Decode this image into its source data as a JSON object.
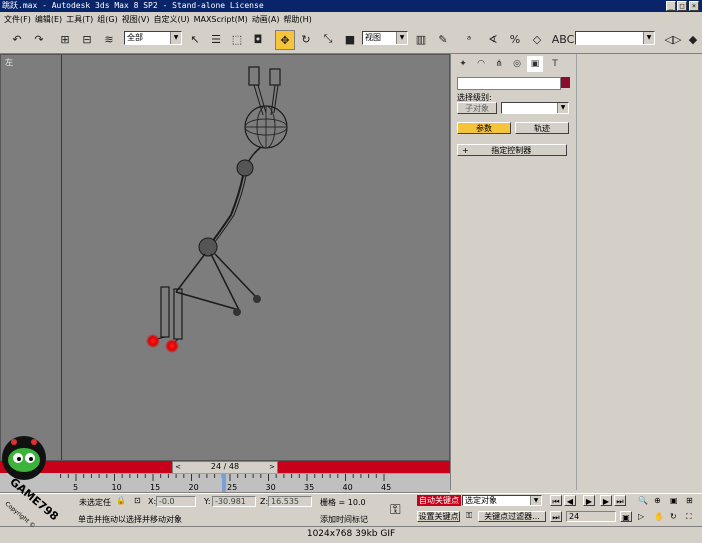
{
  "window": {
    "title": "跳跃.max - Autodesk 3ds Max 8 SP2  - Stand-alone License"
  },
  "menu": [
    "文件(F)",
    "编辑(E)",
    "工具(T)",
    "组(G)",
    "视图(V)",
    "自定义(U)",
    "MAXScript(M)",
    "动画(A)",
    "帮助(H)"
  ],
  "toolbar": {
    "selection_filter": "全部",
    "reference_coord": "视图",
    "named_selection": ""
  },
  "viewport": {
    "label": "左"
  },
  "time": {
    "slider_label": "24 / 48",
    "ticks": [
      "5",
      "10",
      "15",
      "20",
      "25",
      "30",
      "35",
      "40",
      "45"
    ]
  },
  "command_panel": {
    "selection_level_label": "选择级别:",
    "sub_object_button": "子对象",
    "tab_params": "参数",
    "tab_track": "轨迹",
    "rollout_prefix": "+",
    "rollout_title": "指定控制器"
  },
  "status": {
    "selection": "未选定任",
    "x_label": "X:",
    "x_value": "-0.0",
    "y_label": "Y:",
    "y_value": "-30.981",
    "z_label": "Z:",
    "z_value": "16.535",
    "grid": "栅格 = 10.0",
    "prompt": "单击并拖动以选择并移动对象",
    "add_time_tag": "添加时间标记",
    "auto_key": "自动关键点",
    "set_key": "设置关键点",
    "key_mode_dropdown": "选定对象",
    "key_filters": "关键点过滤器...",
    "frame": "24"
  },
  "logo": {
    "text": "GAME798",
    "sub": "Copyright ©"
  },
  "image_info": "1024x768  39kb  GIF"
}
